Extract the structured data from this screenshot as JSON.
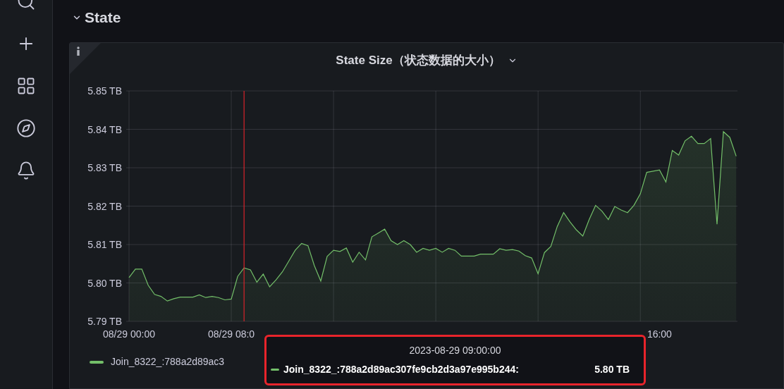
{
  "section": {
    "title": "State",
    "expanded": true
  },
  "panel": {
    "title": "State Size（状态数据的大小）",
    "chart_data": {
      "type": "area",
      "ylim": [
        5.79,
        5.85
      ],
      "yticks": [
        {
          "value": 5.79,
          "label": "5.79 TB"
        },
        {
          "value": 5.8,
          "label": "5.80 TB"
        },
        {
          "value": 5.81,
          "label": "5.81 TB"
        },
        {
          "value": 5.82,
          "label": "5.82 TB"
        },
        {
          "value": 5.83,
          "label": "5.83 TB"
        },
        {
          "value": 5.84,
          "label": "5.84 TB"
        },
        {
          "value": 5.85,
          "label": "5.85 TB"
        }
      ],
      "categories": [
        "08/29 00:00",
        null,
        null,
        null,
        null,
        null,
        null,
        null,
        null,
        null,
        null,
        null,
        null,
        null,
        null,
        null,
        "08/29 08:0",
        null,
        null,
        null,
        null,
        null,
        null,
        null,
        null,
        null,
        null,
        null,
        null,
        null,
        null,
        null,
        null,
        null,
        null,
        null,
        null,
        null,
        null,
        null,
        null,
        null,
        null,
        null,
        null,
        null,
        null,
        null,
        null,
        null,
        null,
        null,
        null,
        null,
        null,
        null,
        null,
        null,
        null,
        null,
        null,
        null,
        null,
        null,
        null,
        null,
        null,
        null,
        null,
        null,
        null,
        null,
        null,
        null,
        null,
        null,
        null,
        null,
        null,
        null,
        null,
        null,
        null,
        "16:00",
        null,
        null,
        null,
        null,
        null,
        null,
        null,
        null,
        null,
        null,
        null,
        null
      ],
      "series": [
        {
          "color": "#73bf69",
          "values": [
            5.8014,
            5.8036,
            5.8036,
            5.7994,
            5.797,
            5.7965,
            5.7953,
            5.7959,
            5.7963,
            5.7963,
            5.7963,
            5.7969,
            5.7962,
            5.7965,
            5.7962,
            5.7956,
            5.7958,
            5.8017,
            5.8039,
            5.8034,
            5.8002,
            5.8023,
            5.799,
            5.8008,
            5.8029,
            5.8057,
            5.8085,
            5.8103,
            5.8097,
            5.8045,
            5.8005,
            5.8069,
            5.8085,
            5.8082,
            5.8091,
            5.8054,
            5.808,
            5.806,
            5.812,
            5.813,
            5.814,
            5.811,
            5.81,
            5.811,
            5.81,
            5.808,
            5.809,
            5.8085,
            5.809,
            5.808,
            5.809,
            5.8085,
            5.807,
            5.807,
            5.807,
            5.8075,
            5.8075,
            5.8075,
            5.8089,
            5.8085,
            5.8087,
            5.8083,
            5.8071,
            5.8065,
            5.8024,
            5.8079,
            5.8095,
            5.8147,
            5.8183,
            5.8159,
            5.8138,
            5.8122,
            5.8165,
            5.8202,
            5.8187,
            5.8165,
            5.8199,
            5.819,
            5.8183,
            5.8202,
            5.8232,
            5.8288,
            5.8291,
            5.8294,
            5.8263,
            5.8345,
            5.8333,
            5.837,
            5.8382,
            5.8363,
            5.8363,
            5.8376,
            5.8153,
            5.8394,
            5.8379,
            5.833
          ]
        }
      ],
      "grid": true
    },
    "legend": [
      {
        "label": "Join_8322_:788a2d89ac3",
        "color": "#73bf69"
      }
    ],
    "tooltip": {
      "time": "2023-08-29 09:00:00",
      "highlighted": true,
      "rows": [
        {
          "label": "Join_8322_:788a2d89ac307fe9cb2d3a97e995b244:",
          "value": "5.80 TB",
          "color": "#73bf69"
        }
      ]
    }
  }
}
